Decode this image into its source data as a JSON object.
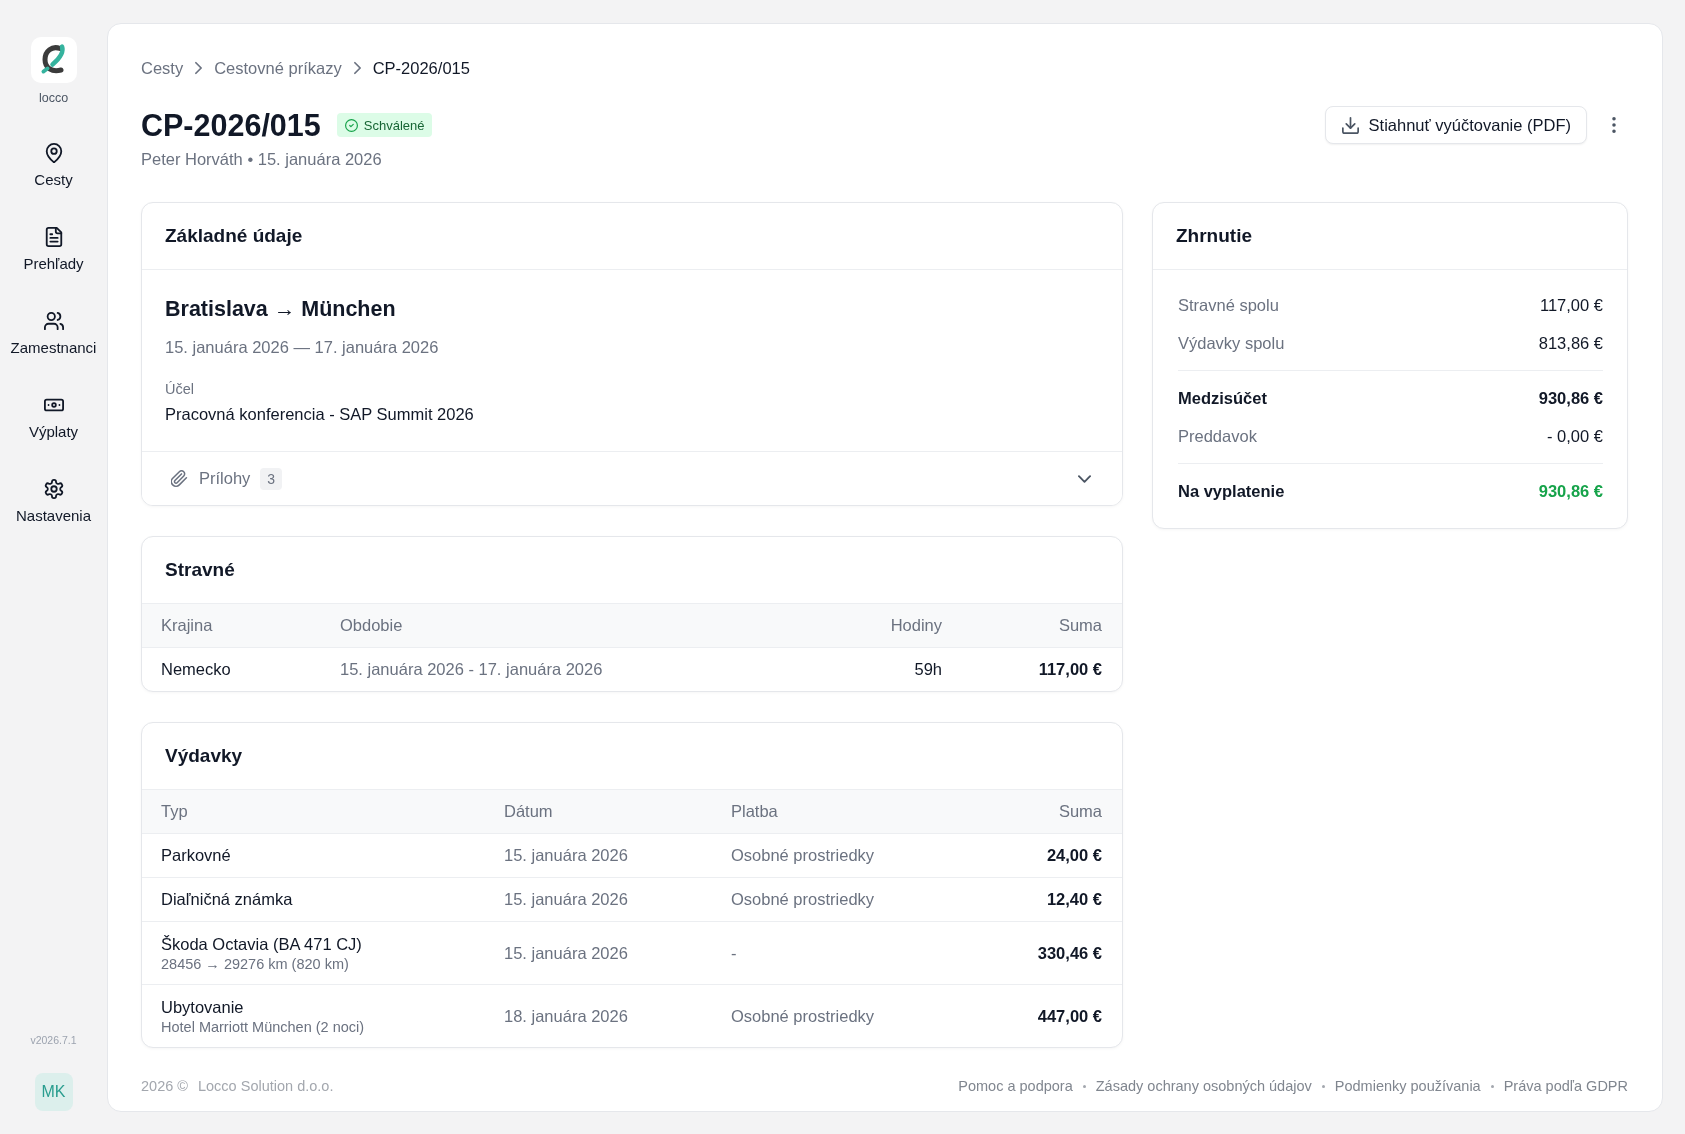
{
  "sidebar": {
    "logo_text": "locco",
    "items": [
      {
        "label": "Cesty",
        "selected": false
      },
      {
        "label": "Prehľady",
        "selected": false
      },
      {
        "label": "Zamestnanci",
        "selected": false
      },
      {
        "label": "Výplaty",
        "selected": false
      },
      {
        "label": "Nastavenia",
        "selected": false
      }
    ],
    "version": "v2026.7.1",
    "avatar": "MK"
  },
  "breadcrumb": [
    {
      "label": "Cesty",
      "current": false
    },
    {
      "label": "Cestovné príkazy",
      "current": false
    },
    {
      "label": "CP-2026/015",
      "current": true
    }
  ],
  "header": {
    "title": "CP-2026/015",
    "status": {
      "label": "Schválené",
      "approved": true
    },
    "subtitle": "Peter Horváth • 15. januára 2026",
    "download_label": "Stiahnuť vyúčtovanie (PDF)"
  },
  "basic_info": {
    "title": "Základné údaje",
    "route": "Bratislava → München",
    "dates": "15. januára 2026 — 17. januára 2026",
    "purpose_label": "Účel",
    "purpose": "Pracovná konferencia - SAP Summit 2026",
    "attachments": {
      "label": "Prílohy",
      "count": "3",
      "expanded": false
    }
  },
  "per_diem": {
    "title": "Stravné",
    "columns": [
      "Krajina",
      "Obdobie",
      "Hodiny",
      "Suma"
    ],
    "rows": [
      {
        "cells": [
          "Nemecko",
          "15. januára 2026 - 17. januára 2026",
          "59h",
          "117,00 €"
        ]
      }
    ]
  },
  "expenses": {
    "title": "Výdavky",
    "columns": [
      "Typ",
      "Dátum",
      "Platba",
      "Suma"
    ],
    "rows": [
      {
        "cells": [
          "Parkovné",
          "15. januára 2026",
          "Osobné prostriedky",
          "24,00 €"
        ]
      },
      {
        "cells": [
          "Diaľničná známka",
          "15. januára 2026",
          "Osobné prostriedky",
          "12,40 €"
        ]
      },
      {
        "cells": [
          "Škoda Octavia (BA 471 CJ)",
          "15. januára 2026",
          "-",
          "330,46 €"
        ],
        "note": "28456 → 29276 km (820 km)"
      },
      {
        "cells": [
          "Ubytovanie",
          "18. januára 2026",
          "Osobné prostriedky",
          "447,00 €"
        ],
        "note": "Hotel Marriott München (2 noci)"
      }
    ]
  },
  "summary": {
    "title": "Zhrnutie",
    "sections": [
      {
        "rows": [
          {
            "label": "Stravné spolu",
            "value": "117,00 €",
            "kind": "item"
          },
          {
            "label": "Výdavky spolu",
            "value": "813,86 €",
            "kind": "item"
          }
        ]
      },
      {
        "rows": [
          {
            "label": "Medzisúčet",
            "value": "930,86 €",
            "kind": "subtotal"
          },
          {
            "label": "Preddavok",
            "value": "- 0,00 €",
            "kind": "item"
          }
        ]
      },
      {
        "rows": [
          {
            "label": "Na vyplatenie",
            "value": "930,86 €",
            "kind": "total"
          }
        ]
      }
    ]
  },
  "footer": {
    "copyright": "2026 ©",
    "company": "Locco Solution d.o.o.",
    "links": [
      "Pomoc a podpora",
      "Zásady ochrany osobných údajov",
      "Podmienky používania",
      "Práva podľa GDPR"
    ]
  }
}
